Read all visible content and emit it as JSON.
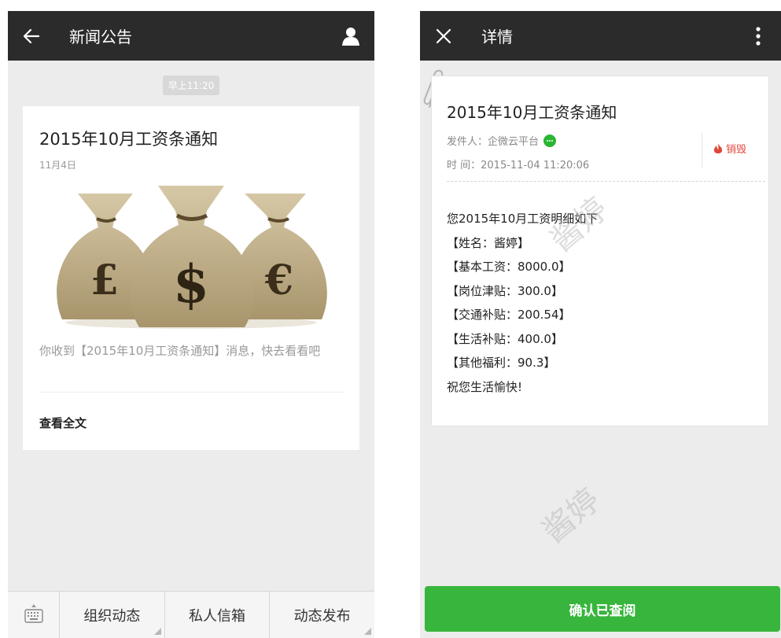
{
  "left": {
    "header": {
      "title": "新闻公告",
      "back_icon": "arrow-left-icon",
      "profile_icon": "user-icon"
    },
    "time_label": "早上11:20",
    "news_card": {
      "title": "2015年10月工资条通知",
      "date": "11月4日",
      "image_symbols": [
        "£",
        "$",
        "€"
      ],
      "description": "你收到【2015年10月工资条通知】消息，快去看看吧",
      "read_more": "查看全文"
    },
    "bottom_nav": {
      "keyboard_icon": "keyboard-icon",
      "items": [
        "组织动态",
        "私人信箱",
        "动态发布"
      ]
    }
  },
  "right": {
    "header": {
      "title": "详情",
      "close_icon": "close-icon",
      "more_icon": "more-vertical-icon"
    },
    "detail": {
      "title": "2015年10月工资条通知",
      "sender_label": "发件人：企微云平台",
      "time_label": "时  间：2015-11-04 11:20:06",
      "destroy_label": "销毁",
      "lines": [
        "您2015年10月工资明细如下",
        "【姓名：酱婷】",
        "【基本工资：8000.0】",
        "【岗位津贴：300.0】",
        "【交通补贴：200.54】",
        "【生活补贴：400.0】",
        "【其他福利：90.3】",
        "祝您生活愉快!"
      ]
    },
    "watermark": "酱婷",
    "confirm_button": "确认已查阅"
  },
  "colors": {
    "header_bg": "#2b2b2b",
    "page_bg": "#ececec",
    "confirm_green": "#38b53d",
    "destroy_red": "#e2463b",
    "wechat_green": "#2ab533"
  }
}
